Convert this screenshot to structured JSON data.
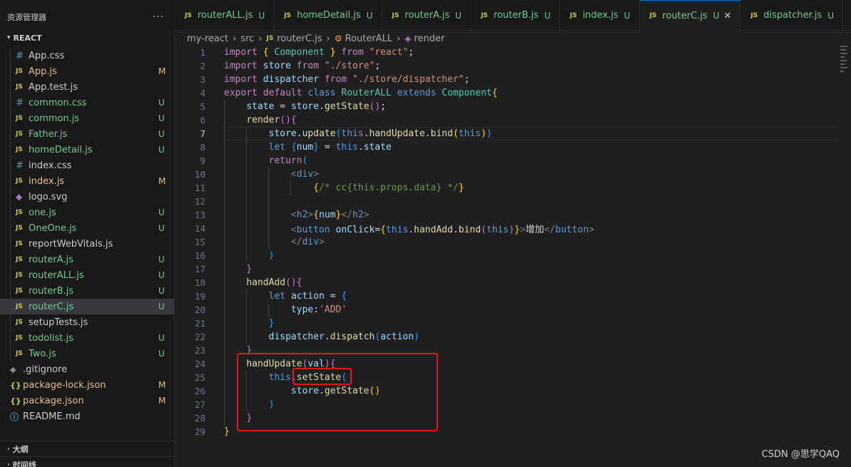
{
  "sidebar": {
    "title": "资源管理器",
    "more_label": "···",
    "folder": "REACT",
    "files": [
      {
        "name": "App.css",
        "icon": "#",
        "type": "css",
        "status": "",
        "color": "c-default"
      },
      {
        "name": "App.js",
        "icon": "JS",
        "type": "js",
        "status": "M",
        "color": "c-modified"
      },
      {
        "name": "App.test.js",
        "icon": "JS",
        "type": "js",
        "status": "",
        "color": "c-default"
      },
      {
        "name": "common.css",
        "icon": "#",
        "type": "css",
        "status": "U",
        "color": "c-untracked"
      },
      {
        "name": "common.js",
        "icon": "JS",
        "type": "js",
        "status": "U",
        "color": "c-untracked"
      },
      {
        "name": "Father.js",
        "icon": "JS",
        "type": "js",
        "status": "U",
        "color": "c-untracked"
      },
      {
        "name": "homeDetail.js",
        "icon": "JS",
        "type": "js",
        "status": "U",
        "color": "c-untracked"
      },
      {
        "name": "index.css",
        "icon": "#",
        "type": "css",
        "status": "",
        "color": "c-default"
      },
      {
        "name": "index.js",
        "icon": "JS",
        "type": "js",
        "status": "M",
        "color": "c-modified"
      },
      {
        "name": "logo.svg",
        "icon": "◆",
        "type": "svg",
        "status": "",
        "color": "c-default"
      },
      {
        "name": "one.js",
        "icon": "JS",
        "type": "js",
        "status": "U",
        "color": "c-untracked"
      },
      {
        "name": "OneOne.js",
        "icon": "JS",
        "type": "js",
        "status": "U",
        "color": "c-untracked"
      },
      {
        "name": "reportWebVitals.js",
        "icon": "JS",
        "type": "js",
        "status": "",
        "color": "c-default"
      },
      {
        "name": "routerA.js",
        "icon": "JS",
        "type": "js",
        "status": "U",
        "color": "c-untracked"
      },
      {
        "name": "routerALL.js",
        "icon": "JS",
        "type": "js",
        "status": "U",
        "color": "c-untracked"
      },
      {
        "name": "routerB.js",
        "icon": "JS",
        "type": "js",
        "status": "U",
        "color": "c-untracked"
      },
      {
        "name": "routerC.js",
        "icon": "JS",
        "type": "js",
        "status": "U",
        "color": "c-untracked",
        "active": true
      },
      {
        "name": "setupTests.js",
        "icon": "JS",
        "type": "js",
        "status": "",
        "color": "c-default"
      },
      {
        "name": "todolist.js",
        "icon": "JS",
        "type": "js",
        "status": "U",
        "color": "c-untracked"
      },
      {
        "name": "Two.js",
        "icon": "JS",
        "type": "js",
        "status": "U",
        "color": "c-untracked"
      }
    ],
    "root_files": [
      {
        "name": ".gitignore",
        "icon": "◆",
        "type": "git",
        "status": "",
        "color": "c-default"
      },
      {
        "name": "package-lock.json",
        "icon": "{}",
        "type": "json",
        "status": "M",
        "color": "c-modified"
      },
      {
        "name": "package.json",
        "icon": "{}",
        "type": "json",
        "status": "M",
        "color": "c-modified"
      },
      {
        "name": "README.md",
        "icon": "ⓘ",
        "type": "info",
        "status": "",
        "color": "c-default"
      }
    ],
    "outline_label": "大纲",
    "timeline_label": "时间线"
  },
  "tabs": [
    {
      "name": "routerALL.js",
      "status": "U",
      "active": false
    },
    {
      "name": "homeDetail.js",
      "status": "U",
      "active": false
    },
    {
      "name": "routerA.js",
      "status": "U",
      "active": false
    },
    {
      "name": "routerB.js",
      "status": "U",
      "active": false
    },
    {
      "name": "index.js",
      "status": "U",
      "active": false
    },
    {
      "name": "routerC.js",
      "status": "U",
      "active": true,
      "close": "✕"
    },
    {
      "name": "dispatcher.js",
      "status": "U",
      "active": false
    }
  ],
  "breadcrumb": {
    "parts": [
      "my-react",
      "src",
      "routerC.js",
      "RouterALL",
      "render"
    ]
  },
  "editor": {
    "current_line": 7,
    "lines": [
      [
        [
          "kw2",
          "import"
        ],
        [
          "txt",
          " "
        ],
        [
          "p1",
          "{"
        ],
        [
          "txt",
          " "
        ],
        [
          "cls",
          "Component"
        ],
        [
          "txt",
          " "
        ],
        [
          "p1",
          "}"
        ],
        [
          "txt",
          " "
        ],
        [
          "kw2",
          "from"
        ],
        [
          "txt",
          " "
        ],
        [
          "str",
          "\"react\""
        ],
        [
          "txt",
          ";"
        ]
      ],
      [
        [
          "kw2",
          "import"
        ],
        [
          "txt",
          " "
        ],
        [
          "id",
          "store"
        ],
        [
          "txt",
          " "
        ],
        [
          "kw2",
          "from"
        ],
        [
          "txt",
          " "
        ],
        [
          "str",
          "\"./store\""
        ],
        [
          "txt",
          ";"
        ]
      ],
      [
        [
          "kw2",
          "import"
        ],
        [
          "txt",
          " "
        ],
        [
          "id",
          "dispatcher"
        ],
        [
          "txt",
          " "
        ],
        [
          "kw2",
          "from"
        ],
        [
          "txt",
          " "
        ],
        [
          "str",
          "\"./store/dispatcher\""
        ],
        [
          "txt",
          ";"
        ]
      ],
      [
        [
          "kw2",
          "export"
        ],
        [
          "txt",
          " "
        ],
        [
          "kw2",
          "default"
        ],
        [
          "txt",
          " "
        ],
        [
          "kw",
          "class"
        ],
        [
          "txt",
          " "
        ],
        [
          "cls",
          "RouterALL"
        ],
        [
          "txt",
          " "
        ],
        [
          "kw",
          "extends"
        ],
        [
          "txt",
          " "
        ],
        [
          "cls",
          "Component"
        ],
        [
          "p1",
          "{"
        ]
      ],
      [
        [
          "txt",
          "    "
        ],
        [
          "id",
          "state"
        ],
        [
          "txt",
          " = "
        ],
        [
          "id",
          "store"
        ],
        [
          "txt",
          "."
        ],
        [
          "fn",
          "getState"
        ],
        [
          "p2",
          "()"
        ],
        [
          "txt",
          ";"
        ]
      ],
      [
        [
          "txt",
          "    "
        ],
        [
          "fn",
          "render"
        ],
        [
          "p2",
          "(){"
        ]
      ],
      [
        [
          "txt",
          "        "
        ],
        [
          "id",
          "store"
        ],
        [
          "txt",
          "."
        ],
        [
          "fn",
          "update"
        ],
        [
          "p3",
          "("
        ],
        [
          "kw",
          "this"
        ],
        [
          "txt",
          "."
        ],
        [
          "fn",
          "handUpdate"
        ],
        [
          "txt",
          "."
        ],
        [
          "fn",
          "bind"
        ],
        [
          "p1",
          "("
        ],
        [
          "kw",
          "this"
        ],
        [
          "p1",
          ")"
        ],
        [
          "p3",
          ")"
        ]
      ],
      [
        [
          "txt",
          "        "
        ],
        [
          "kw",
          "let"
        ],
        [
          "txt",
          " "
        ],
        [
          "p3",
          "{"
        ],
        [
          "id",
          "num"
        ],
        [
          "p3",
          "}"
        ],
        [
          "txt",
          " = "
        ],
        [
          "kw",
          "this"
        ],
        [
          "txt",
          "."
        ],
        [
          "id",
          "state"
        ]
      ],
      [
        [
          "txt",
          "        "
        ],
        [
          "kw2",
          "return"
        ],
        [
          "p3",
          "("
        ]
      ],
      [
        [
          "txt",
          "            "
        ],
        [
          "tagp",
          "<"
        ],
        [
          "tag",
          "div"
        ],
        [
          "tagp",
          ">"
        ]
      ],
      [
        [
          "txt",
          "                "
        ],
        [
          "p1",
          "{"
        ],
        [
          "cm",
          "/* cc{this.props.data} */"
        ],
        [
          "p1",
          "}"
        ]
      ],
      [
        [
          "txt",
          ""
        ]
      ],
      [
        [
          "txt",
          "            "
        ],
        [
          "tagp",
          "<"
        ],
        [
          "tag",
          "h2"
        ],
        [
          "tagp",
          ">"
        ],
        [
          "p1",
          "{"
        ],
        [
          "id",
          "num"
        ],
        [
          "p1",
          "}"
        ],
        [
          "tagp",
          "</"
        ],
        [
          "tag",
          "h2"
        ],
        [
          "tagp",
          ">"
        ]
      ],
      [
        [
          "txt",
          "            "
        ],
        [
          "tagp",
          "<"
        ],
        [
          "tag",
          "button"
        ],
        [
          "txt",
          " "
        ],
        [
          "id",
          "onClick"
        ],
        [
          "txt",
          "="
        ],
        [
          "p1",
          "{"
        ],
        [
          "kw",
          "this"
        ],
        [
          "txt",
          "."
        ],
        [
          "fn",
          "handAdd"
        ],
        [
          "txt",
          "."
        ],
        [
          "fn",
          "bind"
        ],
        [
          "p2",
          "("
        ],
        [
          "kw",
          "this"
        ],
        [
          "p2",
          ")"
        ],
        [
          "p1",
          "}"
        ],
        [
          "tagp",
          ">"
        ],
        [
          "txt",
          "增加"
        ],
        [
          "tagp",
          "</"
        ],
        [
          "tag",
          "button"
        ],
        [
          "tagp",
          ">"
        ]
      ],
      [
        [
          "txt",
          "            "
        ],
        [
          "tagp",
          "</"
        ],
        [
          "tag",
          "div"
        ],
        [
          "tagp",
          ">"
        ]
      ],
      [
        [
          "txt",
          "        "
        ],
        [
          "p3",
          ")"
        ]
      ],
      [
        [
          "txt",
          "    "
        ],
        [
          "p2",
          "}"
        ]
      ],
      [
        [
          "txt",
          "    "
        ],
        [
          "fn",
          "handAdd"
        ],
        [
          "p2",
          "(){"
        ]
      ],
      [
        [
          "txt",
          "        "
        ],
        [
          "kw",
          "let"
        ],
        [
          "txt",
          " "
        ],
        [
          "id",
          "action"
        ],
        [
          "txt",
          " = "
        ],
        [
          "p3",
          "{"
        ]
      ],
      [
        [
          "txt",
          "            "
        ],
        [
          "id",
          "type"
        ],
        [
          "txt",
          ":"
        ],
        [
          "str",
          "'ADD'"
        ]
      ],
      [
        [
          "txt",
          "        "
        ],
        [
          "p3",
          "}"
        ]
      ],
      [
        [
          "txt",
          "        "
        ],
        [
          "id",
          "dispatcher"
        ],
        [
          "txt",
          "."
        ],
        [
          "fn",
          "dispatch"
        ],
        [
          "p3",
          "("
        ],
        [
          "id",
          "action"
        ],
        [
          "p3",
          ")"
        ]
      ],
      [
        [
          "txt",
          "    "
        ],
        [
          "p2",
          "}"
        ]
      ],
      [
        [
          "txt",
          "    "
        ],
        [
          "fn",
          "handUpdate"
        ],
        [
          "p2",
          "("
        ],
        [
          "id",
          "val"
        ],
        [
          "p2",
          "){"
        ]
      ],
      [
        [
          "txt",
          "        "
        ],
        [
          "kw",
          "this"
        ],
        [
          "txt",
          "."
        ],
        [
          "fn",
          "setState"
        ],
        [
          "p3",
          "("
        ]
      ],
      [
        [
          "txt",
          "            "
        ],
        [
          "id",
          "store"
        ],
        [
          "txt",
          "."
        ],
        [
          "fn",
          "getState"
        ],
        [
          "p1",
          "()"
        ]
      ],
      [
        [
          "txt",
          "        "
        ],
        [
          "p3",
          ")"
        ]
      ],
      [
        [
          "txt",
          "    "
        ],
        [
          "p2",
          "}"
        ]
      ],
      [
        [
          "p1",
          "}"
        ]
      ]
    ]
  },
  "watermark": "CSDN @思学QAQ"
}
